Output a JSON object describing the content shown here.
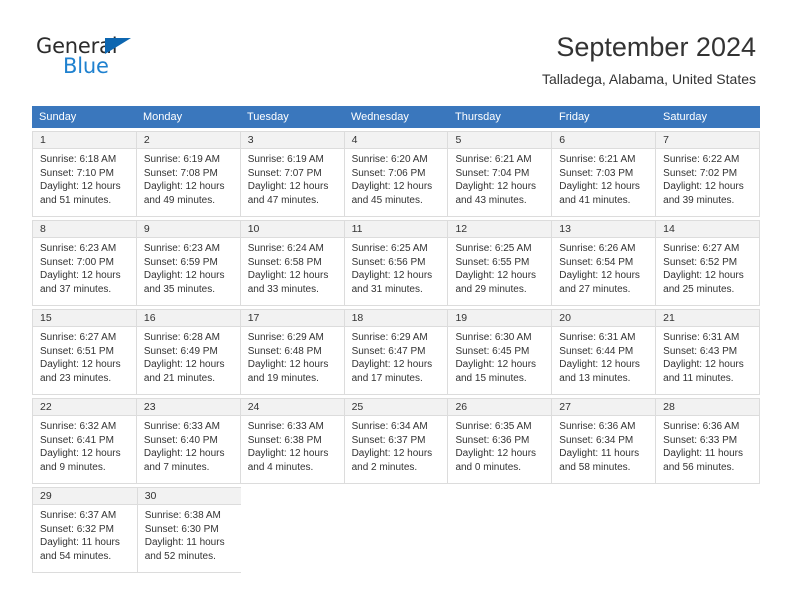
{
  "brand": {
    "name_top": "General",
    "name_bottom": "Blue",
    "triangle_color": "#0d66b0",
    "blue_color": "#1f81cf"
  },
  "header": {
    "title": "September 2024",
    "subtitle": "Talladega, Alabama, United States",
    "header_bg": "#3a77bd",
    "date_band_bg": "#f2f2f2",
    "border_color": "#dcdcdc"
  },
  "weekdays": [
    "Sunday",
    "Monday",
    "Tuesday",
    "Wednesday",
    "Thursday",
    "Friday",
    "Saturday"
  ],
  "weeks": [
    [
      {
        "date": "1",
        "sunrise": "Sunrise: 6:18 AM",
        "sunset": "Sunset: 7:10 PM",
        "daylight1": "Daylight: 12 hours",
        "daylight2": "and 51 minutes."
      },
      {
        "date": "2",
        "sunrise": "Sunrise: 6:19 AM",
        "sunset": "Sunset: 7:08 PM",
        "daylight1": "Daylight: 12 hours",
        "daylight2": "and 49 minutes."
      },
      {
        "date": "3",
        "sunrise": "Sunrise: 6:19 AM",
        "sunset": "Sunset: 7:07 PM",
        "daylight1": "Daylight: 12 hours",
        "daylight2": "and 47 minutes."
      },
      {
        "date": "4",
        "sunrise": "Sunrise: 6:20 AM",
        "sunset": "Sunset: 7:06 PM",
        "daylight1": "Daylight: 12 hours",
        "daylight2": "and 45 minutes."
      },
      {
        "date": "5",
        "sunrise": "Sunrise: 6:21 AM",
        "sunset": "Sunset: 7:04 PM",
        "daylight1": "Daylight: 12 hours",
        "daylight2": "and 43 minutes."
      },
      {
        "date": "6",
        "sunrise": "Sunrise: 6:21 AM",
        "sunset": "Sunset: 7:03 PM",
        "daylight1": "Daylight: 12 hours",
        "daylight2": "and 41 minutes."
      },
      {
        "date": "7",
        "sunrise": "Sunrise: 6:22 AM",
        "sunset": "Sunset: 7:02 PM",
        "daylight1": "Daylight: 12 hours",
        "daylight2": "and 39 minutes."
      }
    ],
    [
      {
        "date": "8",
        "sunrise": "Sunrise: 6:23 AM",
        "sunset": "Sunset: 7:00 PM",
        "daylight1": "Daylight: 12 hours",
        "daylight2": "and 37 minutes."
      },
      {
        "date": "9",
        "sunrise": "Sunrise: 6:23 AM",
        "sunset": "Sunset: 6:59 PM",
        "daylight1": "Daylight: 12 hours",
        "daylight2": "and 35 minutes."
      },
      {
        "date": "10",
        "sunrise": "Sunrise: 6:24 AM",
        "sunset": "Sunset: 6:58 PM",
        "daylight1": "Daylight: 12 hours",
        "daylight2": "and 33 minutes."
      },
      {
        "date": "11",
        "sunrise": "Sunrise: 6:25 AM",
        "sunset": "Sunset: 6:56 PM",
        "daylight1": "Daylight: 12 hours",
        "daylight2": "and 31 minutes."
      },
      {
        "date": "12",
        "sunrise": "Sunrise: 6:25 AM",
        "sunset": "Sunset: 6:55 PM",
        "daylight1": "Daylight: 12 hours",
        "daylight2": "and 29 minutes."
      },
      {
        "date": "13",
        "sunrise": "Sunrise: 6:26 AM",
        "sunset": "Sunset: 6:54 PM",
        "daylight1": "Daylight: 12 hours",
        "daylight2": "and 27 minutes."
      },
      {
        "date": "14",
        "sunrise": "Sunrise: 6:27 AM",
        "sunset": "Sunset: 6:52 PM",
        "daylight1": "Daylight: 12 hours",
        "daylight2": "and 25 minutes."
      }
    ],
    [
      {
        "date": "15",
        "sunrise": "Sunrise: 6:27 AM",
        "sunset": "Sunset: 6:51 PM",
        "daylight1": "Daylight: 12 hours",
        "daylight2": "and 23 minutes."
      },
      {
        "date": "16",
        "sunrise": "Sunrise: 6:28 AM",
        "sunset": "Sunset: 6:49 PM",
        "daylight1": "Daylight: 12 hours",
        "daylight2": "and 21 minutes."
      },
      {
        "date": "17",
        "sunrise": "Sunrise: 6:29 AM",
        "sunset": "Sunset: 6:48 PM",
        "daylight1": "Daylight: 12 hours",
        "daylight2": "and 19 minutes."
      },
      {
        "date": "18",
        "sunrise": "Sunrise: 6:29 AM",
        "sunset": "Sunset: 6:47 PM",
        "daylight1": "Daylight: 12 hours",
        "daylight2": "and 17 minutes."
      },
      {
        "date": "19",
        "sunrise": "Sunrise: 6:30 AM",
        "sunset": "Sunset: 6:45 PM",
        "daylight1": "Daylight: 12 hours",
        "daylight2": "and 15 minutes."
      },
      {
        "date": "20",
        "sunrise": "Sunrise: 6:31 AM",
        "sunset": "Sunset: 6:44 PM",
        "daylight1": "Daylight: 12 hours",
        "daylight2": "and 13 minutes."
      },
      {
        "date": "21",
        "sunrise": "Sunrise: 6:31 AM",
        "sunset": "Sunset: 6:43 PM",
        "daylight1": "Daylight: 12 hours",
        "daylight2": "and 11 minutes."
      }
    ],
    [
      {
        "date": "22",
        "sunrise": "Sunrise: 6:32 AM",
        "sunset": "Sunset: 6:41 PM",
        "daylight1": "Daylight: 12 hours",
        "daylight2": "and 9 minutes."
      },
      {
        "date": "23",
        "sunrise": "Sunrise: 6:33 AM",
        "sunset": "Sunset: 6:40 PM",
        "daylight1": "Daylight: 12 hours",
        "daylight2": "and 7 minutes."
      },
      {
        "date": "24",
        "sunrise": "Sunrise: 6:33 AM",
        "sunset": "Sunset: 6:38 PM",
        "daylight1": "Daylight: 12 hours",
        "daylight2": "and 4 minutes."
      },
      {
        "date": "25",
        "sunrise": "Sunrise: 6:34 AM",
        "sunset": "Sunset: 6:37 PM",
        "daylight1": "Daylight: 12 hours",
        "daylight2": "and 2 minutes."
      },
      {
        "date": "26",
        "sunrise": "Sunrise: 6:35 AM",
        "sunset": "Sunset: 6:36 PM",
        "daylight1": "Daylight: 12 hours",
        "daylight2": "and 0 minutes."
      },
      {
        "date": "27",
        "sunrise": "Sunrise: 6:36 AM",
        "sunset": "Sunset: 6:34 PM",
        "daylight1": "Daylight: 11 hours",
        "daylight2": "and 58 minutes."
      },
      {
        "date": "28",
        "sunrise": "Sunrise: 6:36 AM",
        "sunset": "Sunset: 6:33 PM",
        "daylight1": "Daylight: 11 hours",
        "daylight2": "and 56 minutes."
      }
    ],
    [
      {
        "date": "29",
        "sunrise": "Sunrise: 6:37 AM",
        "sunset": "Sunset: 6:32 PM",
        "daylight1": "Daylight: 11 hours",
        "daylight2": "and 54 minutes."
      },
      {
        "date": "30",
        "sunrise": "Sunrise: 6:38 AM",
        "sunset": "Sunset: 6:30 PM",
        "daylight1": "Daylight: 11 hours",
        "daylight2": "and 52 minutes."
      },
      null,
      null,
      null,
      null,
      null
    ]
  ]
}
